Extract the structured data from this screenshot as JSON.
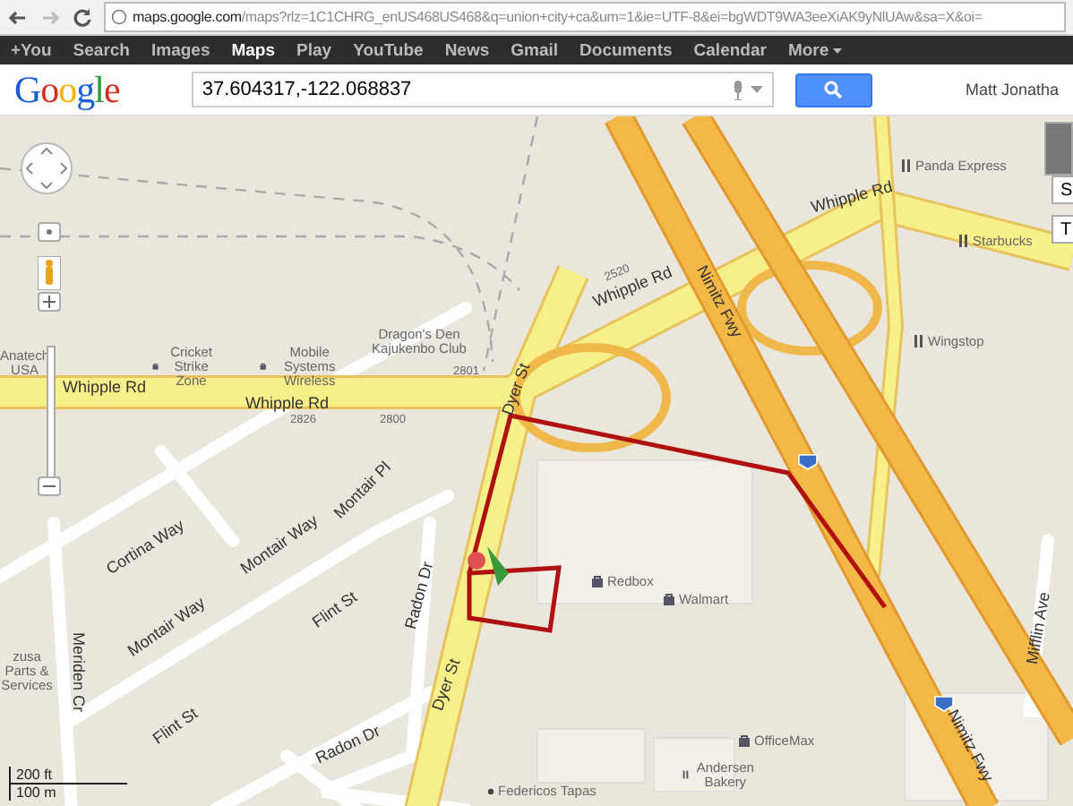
{
  "browser": {
    "host": "maps.google.com",
    "path": "/maps?rlz=1C1CHRG_enUS468US468&q=union+city+ca&um=1&ie=UTF-8&ei=bgWDT9WA3eeXiAK9yNlUAw&sa=X&oi="
  },
  "google_bar": {
    "links": [
      {
        "label": "+You",
        "selected": false
      },
      {
        "label": "Search",
        "selected": false
      },
      {
        "label": "Images",
        "selected": false
      },
      {
        "label": "Maps",
        "selected": true
      },
      {
        "label": "Play",
        "selected": false
      },
      {
        "label": "YouTube",
        "selected": false
      },
      {
        "label": "News",
        "selected": false
      },
      {
        "label": "Gmail",
        "selected": false
      },
      {
        "label": "Documents",
        "selected": false
      },
      {
        "label": "Calendar",
        "selected": false
      },
      {
        "label": "More",
        "selected": false
      }
    ]
  },
  "header": {
    "logo": "Google",
    "search": {
      "value": "37.604317,-122.068837"
    },
    "user": "Matt Jonatha"
  },
  "map": {
    "labels": [
      {
        "text": "Whipple Rd",
        "kind": "road"
      },
      {
        "text": "Whipple Rd",
        "kind": "road"
      },
      {
        "text": "Whipple Rd",
        "kind": "road"
      },
      {
        "text": "Whipple Rd",
        "kind": "road"
      },
      {
        "text": "Nimitz Fwy",
        "kind": "road"
      },
      {
        "text": "Nimitz Fwy",
        "kind": "road"
      },
      {
        "text": "Dyer St",
        "kind": "road"
      },
      {
        "text": "Dyer St",
        "kind": "road"
      },
      {
        "text": "Cortina Way",
        "kind": "road"
      },
      {
        "text": "Montair Way",
        "kind": "road"
      },
      {
        "text": "Montair Way",
        "kind": "road"
      },
      {
        "text": "Montair Pl",
        "kind": "road"
      },
      {
        "text": "Flint St",
        "kind": "road"
      },
      {
        "text": "Flint St",
        "kind": "road"
      },
      {
        "text": "Radon Dr",
        "kind": "road"
      },
      {
        "text": "Radon Dr",
        "kind": "road"
      },
      {
        "text": "Meriden Cr",
        "kind": "road"
      },
      {
        "text": "Mifflin Ave",
        "kind": "road"
      },
      {
        "text": "Anatech USA",
        "kind": "place"
      },
      {
        "text": "Cricket Strike Zone",
        "kind": "shop"
      },
      {
        "text": "Mobile Systems Wireless",
        "kind": "shop"
      },
      {
        "text": "Dragon's Den Kajukenbo Club",
        "kind": "place"
      },
      {
        "text": "Panda Express",
        "kind": "restaurant"
      },
      {
        "text": "Starbucks",
        "kind": "restaurant"
      },
      {
        "text": "Wingstop",
        "kind": "restaurant"
      },
      {
        "text": "Redbox",
        "kind": "shop"
      },
      {
        "text": "Walmart",
        "kind": "shop"
      },
      {
        "text": "OfficeMax",
        "kind": "shop"
      },
      {
        "text": "Andersen Bakery",
        "kind": "restaurant"
      },
      {
        "text": "Federicos Tapas",
        "kind": "place"
      },
      {
        "text": "zusa Parts & Services",
        "kind": "place"
      },
      {
        "text": "2801",
        "kind": "number"
      },
      {
        "text": "2826",
        "kind": "number"
      },
      {
        "text": "2800",
        "kind": "number"
      },
      {
        "text": "2520",
        "kind": "number"
      }
    ],
    "scale": [
      "200 ft",
      "100 m"
    ],
    "side_buttons": [
      "S",
      "T"
    ]
  }
}
